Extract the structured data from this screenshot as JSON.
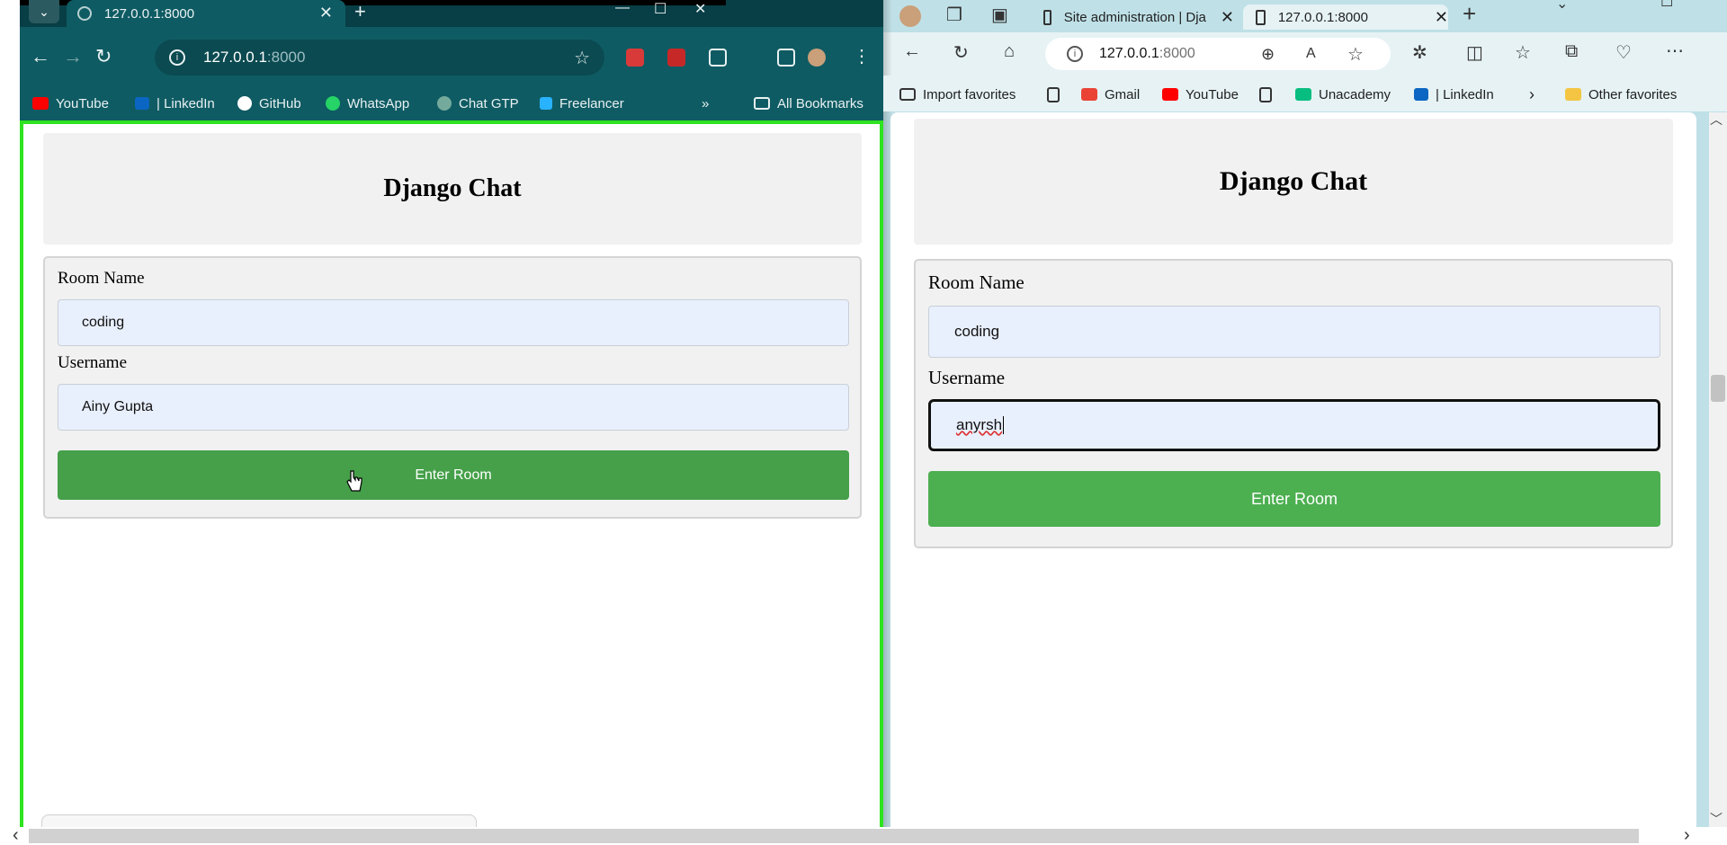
{
  "chrome": {
    "tab_title": "127.0.0.1:8000",
    "address_host": "127.0.0.1",
    "address_port": ":8000",
    "bookmarks": [
      "YouTube",
      "| LinkedIn",
      "GitHub",
      "WhatsApp",
      "Chat GTP",
      "Freelancer"
    ],
    "all_bookmarks": "All Bookmarks",
    "more_bookmarks": "»",
    "page": {
      "title": "Django Chat",
      "room_label": "Room Name",
      "room_value": "coding",
      "username_label": "Username",
      "username_value": "Ainy Gupta",
      "button_label": "Enter Room"
    }
  },
  "edge": {
    "tabs": [
      "Site administration | Dja",
      "127.0.0.1:8000"
    ],
    "address_host": "127.0.0.1",
    "address_port": ":8000",
    "bookmarks": [
      "Import favorites",
      "Gmail",
      "YouTube",
      "Unacademy",
      "| LinkedIn"
    ],
    "other_favorites": "Other favorites",
    "page": {
      "title": "Django Chat",
      "room_label": "Room Name",
      "room_value": "coding",
      "username_label": "Username",
      "username_value": "anyrsh",
      "button_label": "Enter Room"
    }
  },
  "colors": {
    "chrome_frame": "#0f5b63",
    "active_window_outline": "#2ee31f",
    "enter_button": "#4caf50",
    "input_bg": "#e9f0fd",
    "panel_bg": "#f1f1f1",
    "edge_frame": "#bfe0e7"
  }
}
